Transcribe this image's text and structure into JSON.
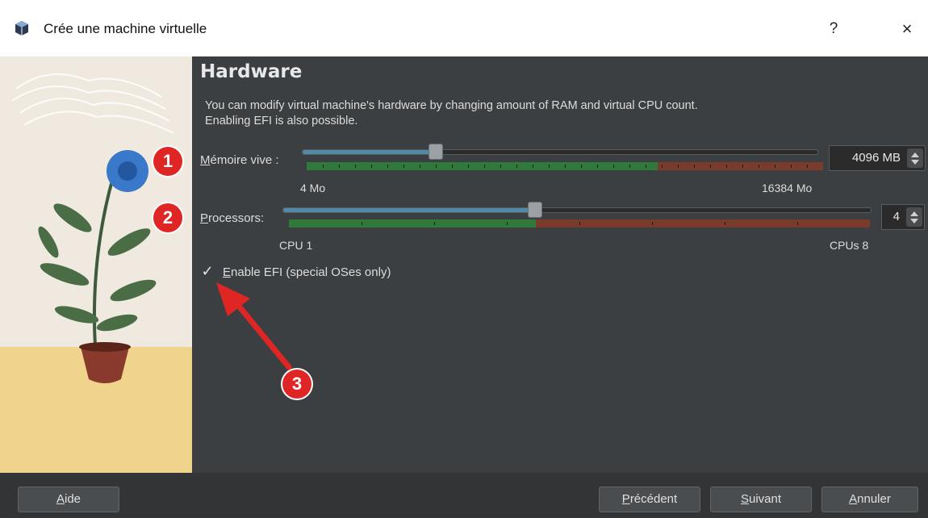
{
  "window": {
    "title": "Crée une machine virtuelle",
    "help": "?",
    "close": "×"
  },
  "page": {
    "heading": "Hardware",
    "description_line1": "You can modify virtual machine's hardware by changing amount of RAM and virtual CPU count.",
    "description_line2": "Enabling EFI is also possible."
  },
  "memory": {
    "label_accel": "M",
    "label_rest": "émoire vive :",
    "value": "4096 MB",
    "min_label": "4 Mo",
    "max_label": "16384 Mo",
    "fraction": 0.25,
    "track_color": "#4f8ba8"
  },
  "processors": {
    "label_accel": "P",
    "label_rest": "rocessors:",
    "value": "4",
    "min_label": "CPU 1",
    "max_label": "CPUs 8",
    "fraction": 0.43
  },
  "efi": {
    "check": "✓",
    "label_accel": "E",
    "label_rest": "nable EFI (special OSes only)"
  },
  "buttons": {
    "help_accel": "A",
    "help_rest": "ide",
    "back_accel": "P",
    "back_rest": "récédent",
    "next_accel": "S",
    "next_rest": "uivant",
    "cancel_accel": "A",
    "cancel_rest": "nnuler"
  },
  "annotations": {
    "badge1": "1",
    "badge2": "2",
    "badge3": "3",
    "color": "#e02525"
  }
}
